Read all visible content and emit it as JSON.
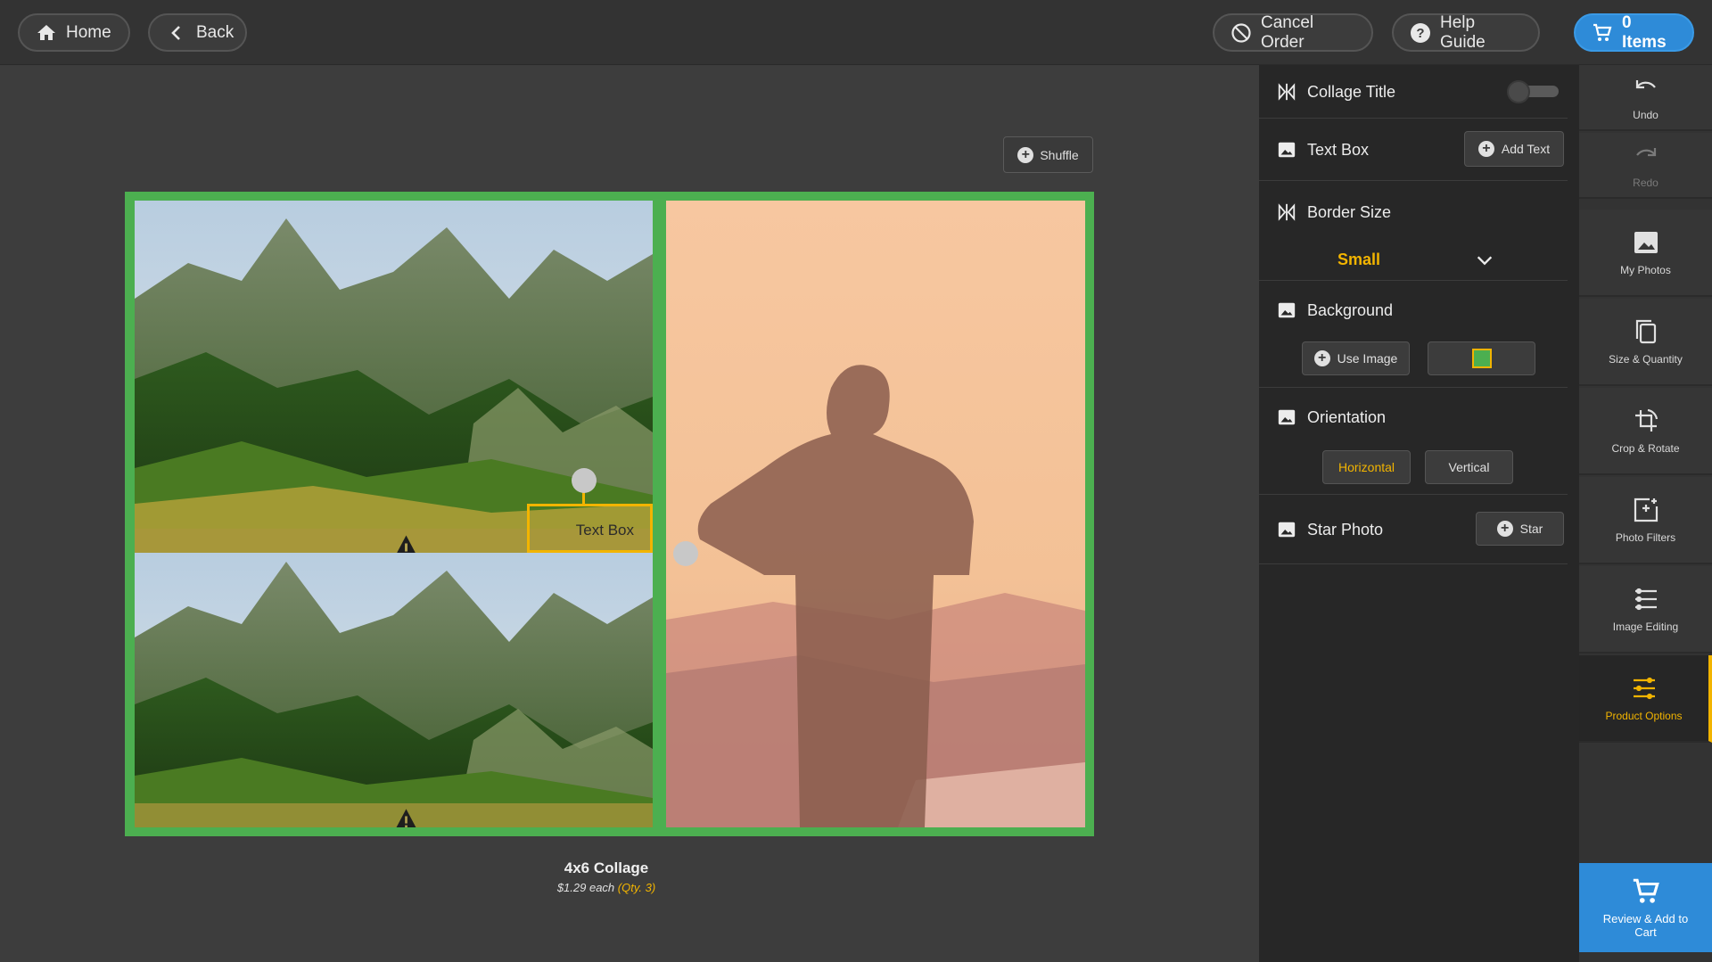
{
  "topbar": {
    "home": "Home",
    "back": "Back",
    "cancel_order": "Cancel Order",
    "help_guide": "Help Guide",
    "cart": "0 Items"
  },
  "canvas": {
    "shuffle": "Shuffle",
    "text_box_label": "Text Box",
    "product_title": "4x6 Collage",
    "price": "$1.29 each",
    "qty": "(Qty. 3)",
    "collage_color": "#4caf50",
    "selection_color": "#f2b400"
  },
  "options": {
    "collage_title": {
      "label": "Collage Title",
      "enabled": false
    },
    "text_box": {
      "label": "Text Box",
      "button": "Add Text"
    },
    "border_size": {
      "label": "Border Size",
      "value": "Small"
    },
    "background": {
      "label": "Background",
      "button": "Use Image",
      "color": "#4caf50"
    },
    "orientation": {
      "label": "Orientation",
      "options": [
        "Horizontal",
        "Vertical"
      ],
      "selected": "Horizontal"
    },
    "star_photo": {
      "label": "Star Photo",
      "button": "Star"
    }
  },
  "tools": {
    "undo": "Undo",
    "redo": "Redo",
    "my_photos": "My Photos",
    "size_quantity": "Size & Quantity",
    "crop_rotate": "Crop & Rotate",
    "photo_filters": "Photo Filters",
    "image_editing": "Image Editing",
    "product_options": "Product Options",
    "review_cart": "Review & Add to Cart"
  },
  "colors": {
    "accent": "#f2b400",
    "primary": "#2e8bd8"
  }
}
